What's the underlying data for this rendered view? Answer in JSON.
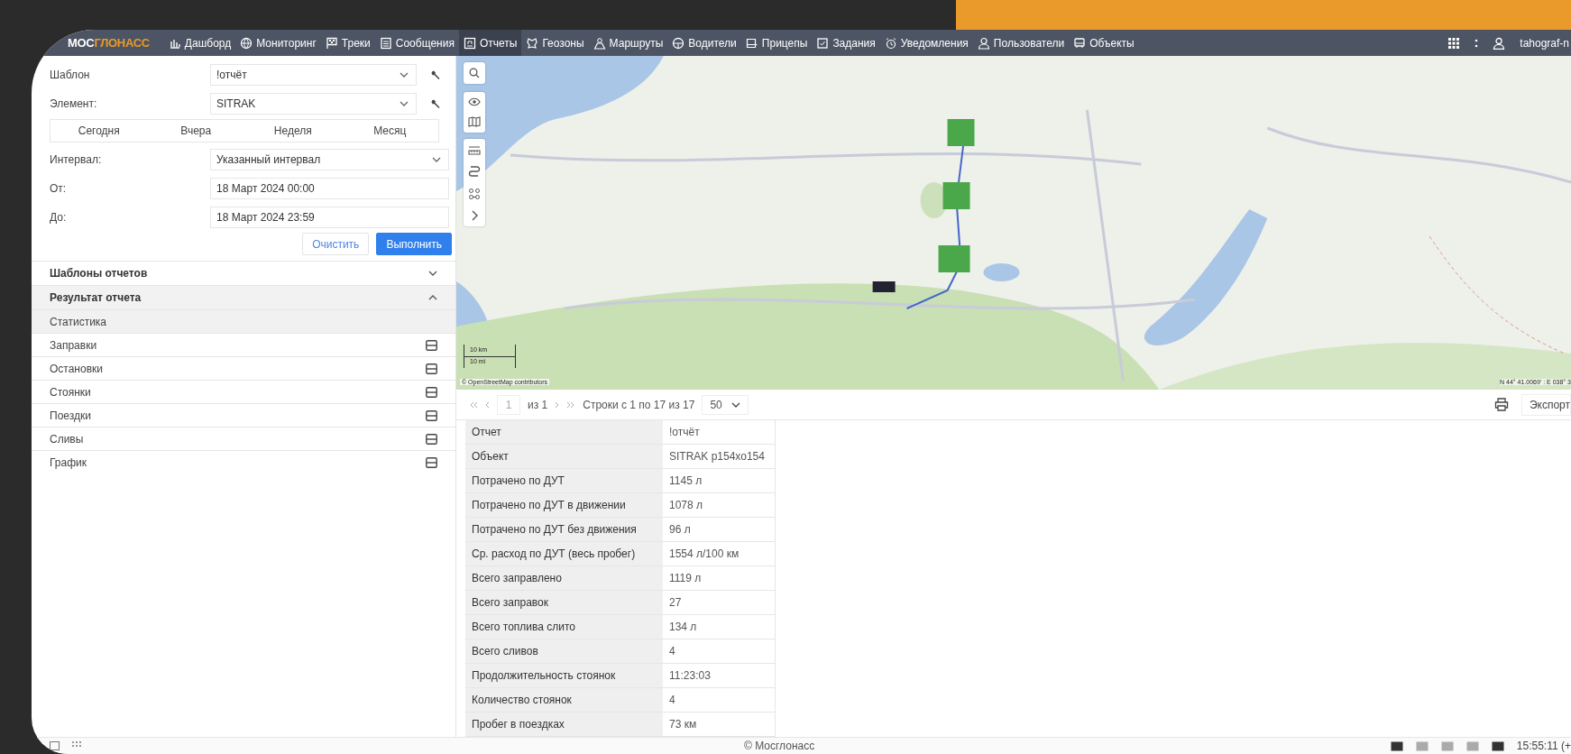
{
  "brand": {
    "prefix": "МОС",
    "suffix": "ГЛОНАСС"
  },
  "nav": [
    {
      "label": "Дашборд",
      "selected": false
    },
    {
      "label": "Мониторинг",
      "selected": false
    },
    {
      "label": "Треки",
      "selected": false
    },
    {
      "label": "Сообщения",
      "selected": false
    },
    {
      "label": "Отчеты",
      "selected": true
    },
    {
      "label": "Геозоны",
      "selected": false
    },
    {
      "label": "Маршруты",
      "selected": false
    },
    {
      "label": "Водители",
      "selected": false
    },
    {
      "label": "Прицепы",
      "selected": false
    },
    {
      "label": "Задания",
      "selected": false
    },
    {
      "label": "Уведомления",
      "selected": false
    },
    {
      "label": "Пользователи",
      "selected": false
    },
    {
      "label": "Объекты",
      "selected": false
    }
  ],
  "user": {
    "name": "tahograf-n"
  },
  "form": {
    "template": {
      "label": "Шаблон",
      "value": "!отчёт"
    },
    "element": {
      "label": "Элемент:",
      "value": "SITRAK"
    },
    "periods": [
      "Сегодня",
      "Вчера",
      "Неделя",
      "Месяц"
    ],
    "interval": {
      "label": "Интервал:",
      "value": "Указанный интервал"
    },
    "from": {
      "label": "От:",
      "value": "18 Март 2024 00:00"
    },
    "to": {
      "label": "До:",
      "value": "18 Март 2024 23:59"
    },
    "clear": "Очистить",
    "run": "Выполнить"
  },
  "sections": [
    {
      "title": "Шаблоны отчетов",
      "expanded": false
    },
    {
      "title": "Результат отчета",
      "expanded": true
    }
  ],
  "results": [
    {
      "label": "Статистика",
      "kind": "summary",
      "selected": true
    },
    {
      "label": "Заправки",
      "kind": "table",
      "selected": false
    },
    {
      "label": "Остановки",
      "kind": "table",
      "selected": false
    },
    {
      "label": "Стоянки",
      "kind": "table",
      "selected": false
    },
    {
      "label": "Поездки",
      "kind": "table",
      "selected": false
    },
    {
      "label": "Сливы",
      "kind": "table",
      "selected": false
    },
    {
      "label": "График",
      "kind": "table",
      "selected": false
    }
  ],
  "map": {
    "kind": "picture",
    "scale_km": "10 km",
    "scale_mi": "10 mi",
    "attribution": "© OpenStreetMap contributors",
    "coords": "N 44° 41.0069' : E 038° 3"
  },
  "pager": {
    "page": "1",
    "of": "из 1",
    "rows": "Строки с 1 по 17 из 17",
    "per_page": "50",
    "export": "Экспорт"
  },
  "table": {
    "rows": [
      [
        "Отчет",
        "!отчёт"
      ],
      [
        "Объект",
        "SITRAK р154хо154"
      ],
      [
        "Потрачено по ДУТ",
        "1145 л"
      ],
      [
        "Потрачено по ДУТ в движении",
        "1078 л"
      ],
      [
        "Потрачено по ДУТ без движения",
        "96 л"
      ],
      [
        "Ср. расход по ДУТ (весь пробег)",
        "1554 л/100 км"
      ],
      [
        "Всего заправлено",
        "1119 л"
      ],
      [
        "Всего заправок",
        "27"
      ],
      [
        "Всего топлива слито",
        "134 л"
      ],
      [
        "Всего сливов",
        "4"
      ],
      [
        "Продолжительность стоянок",
        "11:23:03"
      ],
      [
        "Количество стоянок",
        "4"
      ],
      [
        "Пробег в поездках",
        "73 км"
      ]
    ]
  },
  "footer": {
    "copyright": "© Мосглонасс",
    "time": "15:55:11 (+"
  }
}
